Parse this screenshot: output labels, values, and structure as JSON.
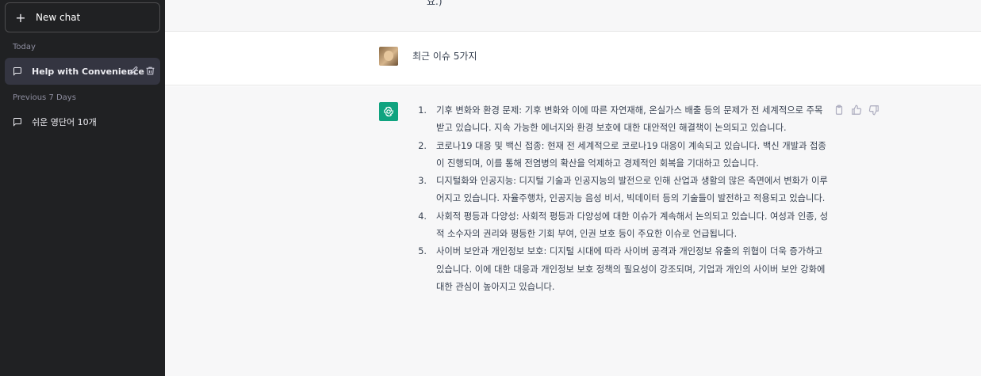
{
  "sidebar": {
    "new_chat_label": "New chat",
    "sections": [
      {
        "title": "Today",
        "items": [
          {
            "label": "Help with Convenience",
            "active": true
          }
        ]
      },
      {
        "title": "Previous 7 Days",
        "items": [
          {
            "label": "쉬운 영단어 10개",
            "active": false
          }
        ]
      }
    ]
  },
  "conversation": {
    "previous_tail": "요.)",
    "user_message": "최근 이슈 5가지",
    "assistant_items": [
      "기후 변화와 환경 문제: 기후 변화와 이에 따른 자연재해, 온실가스 배출 등의 문제가 전 세계적으로 주목받고 있습니다. 지속 가능한 에너지와 환경 보호에 대한 대안적인 해결책이 논의되고 있습니다.",
      "코로나19 대응 및 백신 접종: 현재 전 세계적으로 코로나19 대응이 계속되고 있습니다. 백신 개발과 접종이 진행되며, 이를 통해 전염병의 확산을 억제하고 경제적인 회복을 기대하고 있습니다.",
      "디지털화와 인공지능: 디지털 기술과 인공지능의 발전으로 인해 산업과 생활의 많은 측면에서 변화가 이루어지고 있습니다. 자율주행차, 인공지능 음성 비서, 빅데이터 등의 기술들이 발전하고 적용되고 있습니다.",
      "사회적 평등과 다양성: 사회적 평등과 다양성에 대한 이슈가 계속해서 논의되고 있습니다. 여성과 인종, 성적 소수자의 권리와 평등한 기회 부여, 인권 보호 등이 주요한 이슈로 언급됩니다.",
      "사이버 보안과 개인정보 보호: 디지털 시대에 따라 사이버 공격과 개인정보 유출의 위협이 더욱 증가하고 있습니다. 이에 대한 대응과 개인정보 보호 정책의 필요성이 강조되며, 기업과 개인의 사이버 보안 강화에 대한 관심이 높아지고 있습니다."
    ],
    "item_numbers": [
      "1.",
      "2.",
      "3.",
      "4.",
      "5."
    ]
  },
  "icons": {
    "new_chat": "plus-icon",
    "chat": "message-icon",
    "edit": "pencil-icon",
    "delete": "trash-icon",
    "copy": "clipboard-icon",
    "like": "thumbs-up-icon",
    "dislike": "thumbs-down-icon"
  },
  "colors": {
    "sidebar_bg": "#202123",
    "accent": "#10a37f",
    "assistant_bg": "#f7f7f8"
  }
}
